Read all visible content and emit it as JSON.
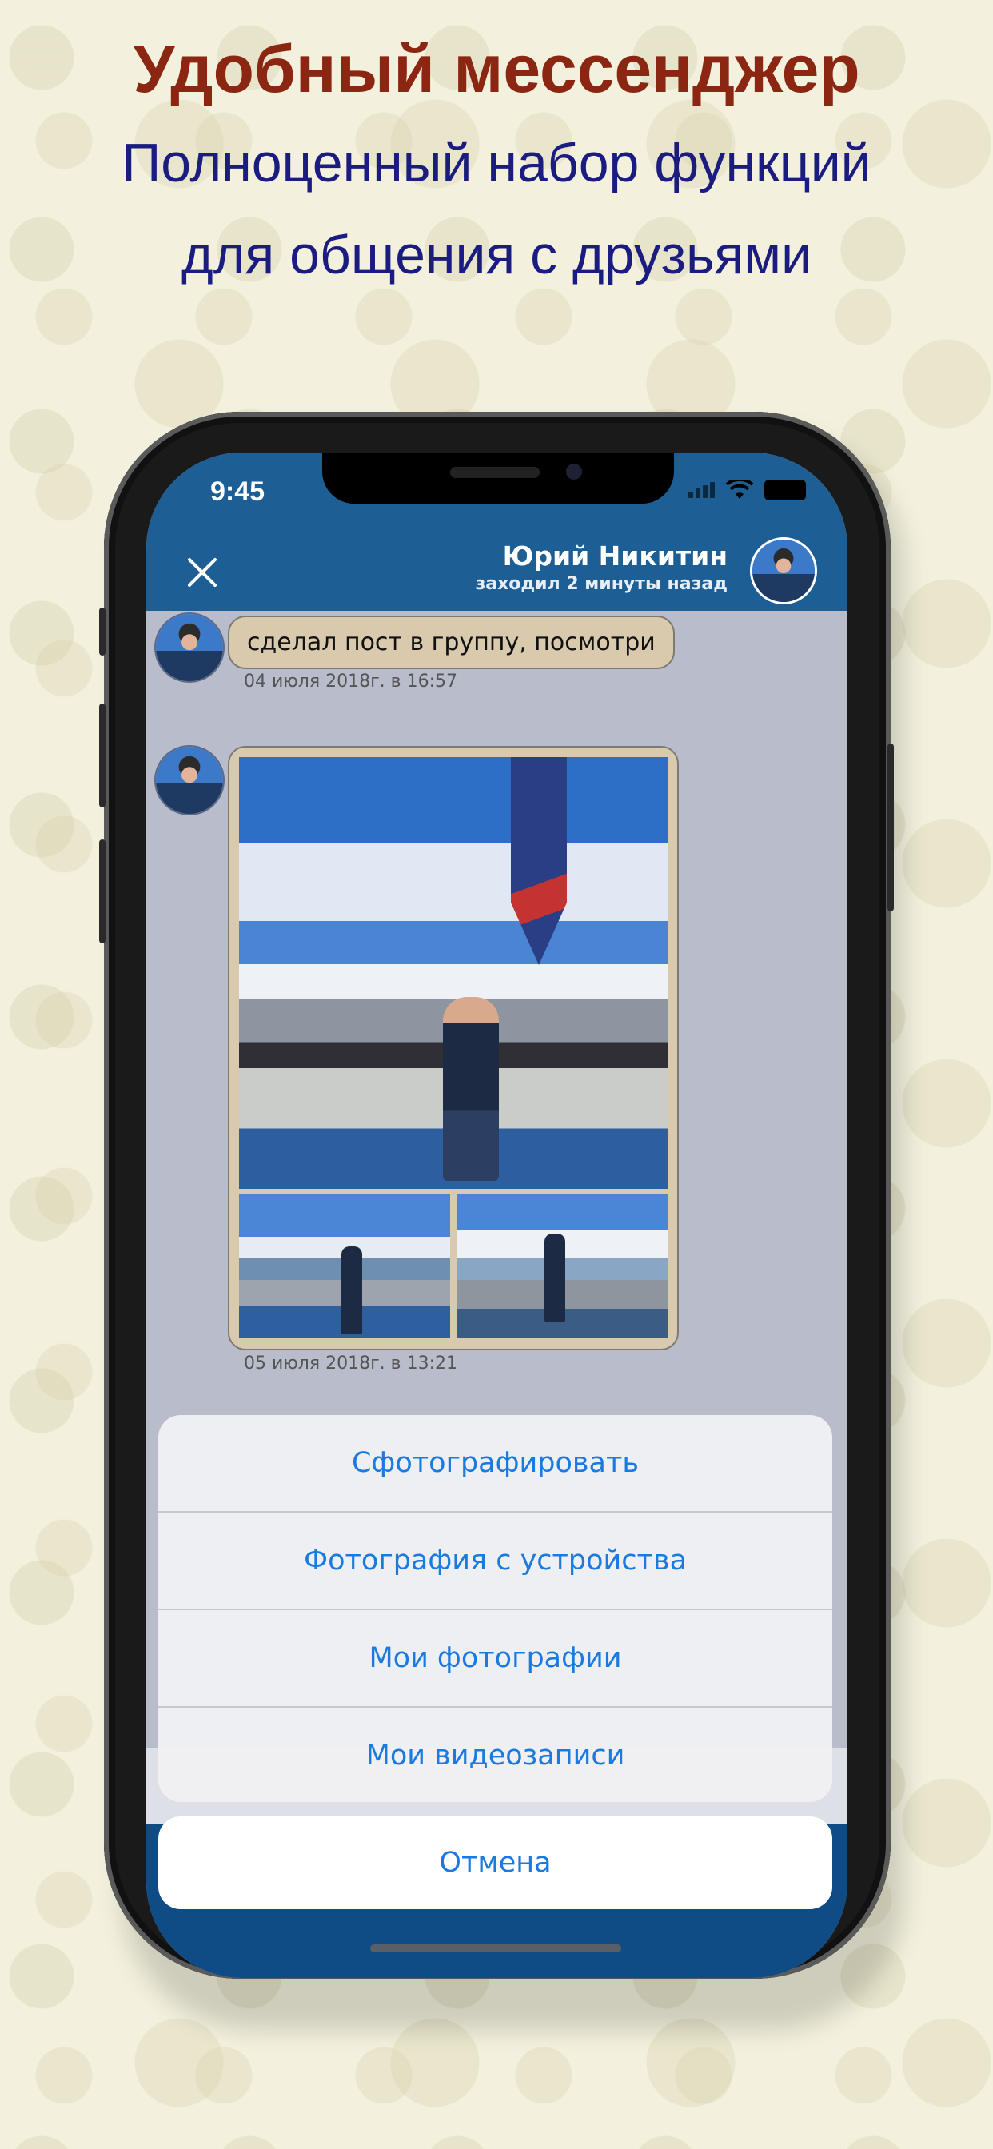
{
  "promo": {
    "title": "Удобный мессенджер",
    "subtitle_line1": "Полноценный набор функций",
    "subtitle_line2": "для общения с друзьями"
  },
  "status_bar": {
    "time": "9:45",
    "icons": [
      "signal-icon",
      "wifi-icon",
      "battery-icon"
    ]
  },
  "chat_header": {
    "close_icon": "close-icon",
    "contact_name": "Юрий Никитин",
    "contact_status": "заходил 2 минуты назад"
  },
  "messages": [
    {
      "text": "сделал пост в группу, посмотри",
      "time": "04 июля 2018г. в 16:57"
    },
    {
      "type": "photo-album",
      "photo_count": 3,
      "time": "05 июля 2018г. в 13:21"
    }
  ],
  "action_sheet": {
    "items": [
      "Сфотографировать",
      "Фотография с устройства",
      "Мои фотографии",
      "Мои видеозаписи"
    ],
    "cancel": "Отмена"
  },
  "colors": {
    "header": "#1d5f95",
    "bubble": "#d9c9ad",
    "action_text": "#1a7ae0",
    "title": "#8b2612",
    "subtitle": "#1b1c80"
  }
}
